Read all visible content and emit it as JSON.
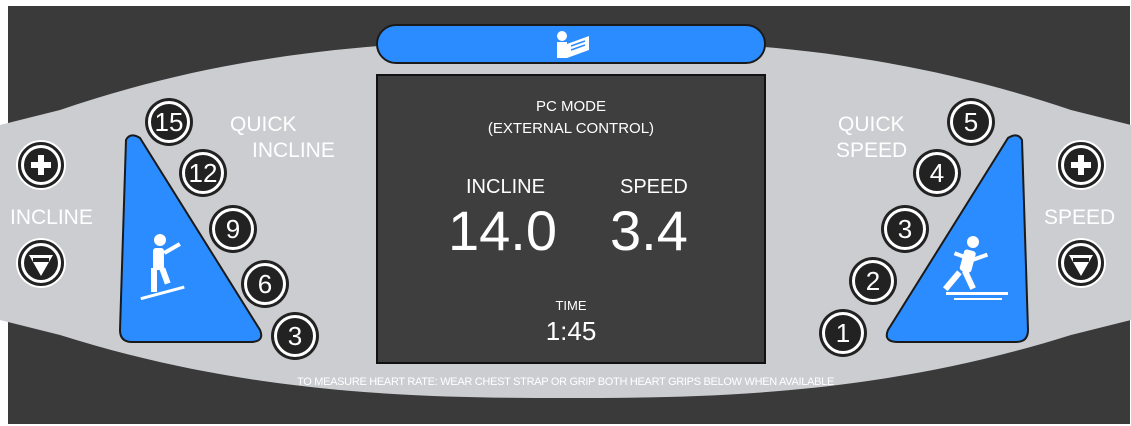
{
  "console": {
    "manual_icon": "manual-book-icon",
    "colors": {
      "panel": "#cbcdd0",
      "frame": "#3a3a3a",
      "accent_blue": "#2b8cff",
      "screen": "#3e3e3e"
    },
    "left": {
      "quick_label_1": "QUICK",
      "quick_label_2": "INCLINE",
      "side_label": "INCLINE",
      "quick_buttons": [
        "15",
        "12",
        "9",
        "6",
        "3"
      ],
      "panel_icon": "stair-climber-icon"
    },
    "right": {
      "quick_label_1": "QUICK",
      "quick_label_2": "SPEED",
      "side_label": "SPEED",
      "quick_buttons": [
        "5",
        "4",
        "3",
        "2",
        "1"
      ],
      "panel_icon": "runner-icon"
    },
    "screen": {
      "mode_line1": "PC MODE",
      "mode_line2": "(EXTERNAL CONTROL)",
      "incline_label": "INCLINE",
      "incline_value": "14.0",
      "speed_label": "SPEED",
      "speed_value": "3.4",
      "time_label": "TIME",
      "time_value": "1:45"
    },
    "footer_note": "TO MEASURE HEART RATE: WEAR CHEST STRAP OR GRIP BOTH HEART GRIPS BELOW WHEN AVAILABLE"
  }
}
